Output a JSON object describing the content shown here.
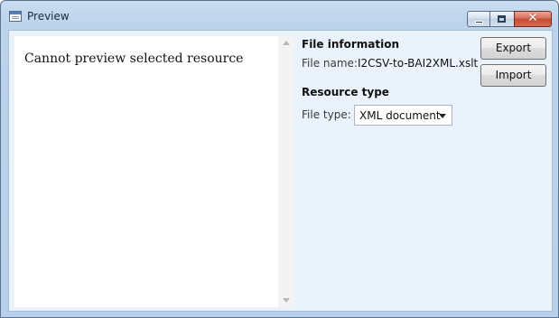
{
  "window": {
    "title": "Preview"
  },
  "preview": {
    "message": "Cannot preview selected resource"
  },
  "file_information": {
    "heading": "File information",
    "file_name_label": "File name:",
    "file_name_value": "I2CSV-to-BAI2XML.xslt"
  },
  "resource_type": {
    "heading": "Resource type",
    "file_type_label": "File type:",
    "file_type_selected": "XML document"
  },
  "actions": {
    "export_label": "Export",
    "import_label": "Import"
  }
}
